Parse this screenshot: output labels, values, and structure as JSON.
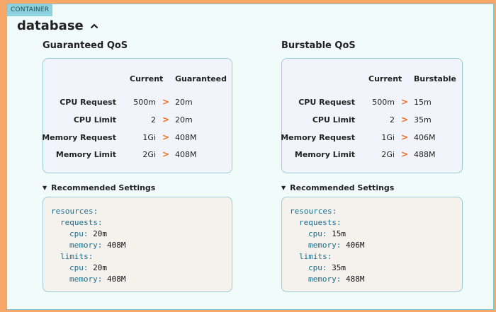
{
  "container": {
    "tag": "CONTAINER",
    "name": "database"
  },
  "guaranteed": {
    "title": "Guaranteed QoS",
    "headers": {
      "current": "Current",
      "target": "Guaranteed"
    },
    "rows": [
      {
        "label": "CPU Request",
        "current": "500m",
        "target": "20m"
      },
      {
        "label": "CPU Limit",
        "current": "2",
        "target": "20m"
      },
      {
        "label": "Memory Request",
        "current": "1Gi",
        "target": "408M"
      },
      {
        "label": "Memory Limit",
        "current": "2Gi",
        "target": "408M"
      }
    ],
    "recommended_label": "Recommended Settings",
    "yaml": {
      "resources": "resources",
      "requests": "requests",
      "limits": "limits",
      "req_cpu_key": "cpu",
      "req_cpu": "20m",
      "req_mem_key": "memory",
      "req_mem": "408M",
      "lim_cpu_key": "cpu",
      "lim_cpu": "20m",
      "lim_mem_key": "memory",
      "lim_mem": "408M"
    }
  },
  "burstable": {
    "title": "Burstable QoS",
    "headers": {
      "current": "Current",
      "target": "Burstable"
    },
    "rows": [
      {
        "label": "CPU Request",
        "current": "500m",
        "target": "15m"
      },
      {
        "label": "CPU Limit",
        "current": "2",
        "target": "35m"
      },
      {
        "label": "Memory Request",
        "current": "1Gi",
        "target": "406M"
      },
      {
        "label": "Memory Limit",
        "current": "2Gi",
        "target": "488M"
      }
    ],
    "recommended_label": "Recommended Settings",
    "yaml": {
      "resources": "resources",
      "requests": "requests",
      "limits": "limits",
      "req_cpu_key": "cpu",
      "req_cpu": "15m",
      "req_mem_key": "memory",
      "req_mem": "406M",
      "lim_cpu_key": "cpu",
      "lim_cpu": "35m",
      "lim_mem_key": "memory",
      "lim_mem": "488M"
    }
  },
  "arrow_glyph": ">",
  "colors": {
    "accent": "#f26a1b",
    "border": "#9ccbd8",
    "key": "#1a6f8f"
  }
}
